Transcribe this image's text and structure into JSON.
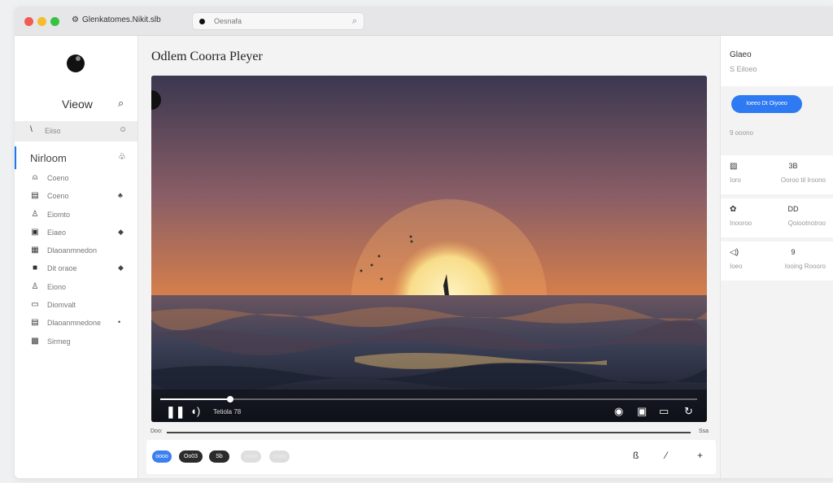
{
  "window": {
    "app_title": "Glenkatomes.Nikit.slb",
    "address": "Oesnafa"
  },
  "sidebar": {
    "view_label": "Vieow",
    "top_item": {
      "label": "Eiiso"
    },
    "section": {
      "label": "Nirloom"
    },
    "items": [
      {
        "label": "Coeno",
        "icon": "person-icon",
        "glyph": "⍝"
      },
      {
        "label": "Coeno",
        "icon": "folder-icon",
        "glyph": "▤",
        "badge": "♣"
      },
      {
        "label": "Eiomto",
        "icon": "person-icon",
        "glyph": "♙"
      },
      {
        "label": "Eiaeo",
        "icon": "calendar-icon",
        "glyph": "▣",
        "badge": "◆"
      },
      {
        "label": "Dlaoanmnedon",
        "icon": "grid-icon",
        "glyph": "▦"
      },
      {
        "label": "Dit oraoe",
        "icon": "stack-icon",
        "glyph": "■",
        "badge": "◆"
      },
      {
        "label": "Eiono",
        "icon": "user-icon",
        "glyph": "♙"
      },
      {
        "label": "Diomvalt",
        "icon": "window-icon",
        "glyph": "▭"
      },
      {
        "label": "Dlaoanmnedone",
        "icon": "layers-icon",
        "glyph": "▤",
        "badge": "•"
      },
      {
        "label": "Sirmeg",
        "icon": "settings-icon",
        "glyph": "▩"
      }
    ]
  },
  "main": {
    "title": "Odlem Coorra Pleyer",
    "player": {
      "time": "Tetiola 78",
      "progress": 0.13,
      "timeline_start": "Doo:",
      "timeline_end": "Ssa"
    },
    "bottom_bar": {
      "pills": [
        {
          "label": "oooo",
          "color": "#3b7ff0"
        },
        {
          "label": "Oo03",
          "color": "#2b2b2b"
        },
        {
          "label": "Sb",
          "color": "#2b2b2b"
        },
        {
          "label": "oooo",
          "color": "#dedede"
        },
        {
          "label": "oooo",
          "color": "#dedede"
        }
      ]
    }
  },
  "right_panel": {
    "title": "Glaeo",
    "subtitle": "S  Eiloeo",
    "button": "Ioeeo Dt Oiyoeo",
    "note": "9 ooono",
    "cards": [
      {
        "top_right": "3B",
        "bottom_left": "Ioro",
        "bottom_right": "Ooroo til Iroono"
      },
      {
        "top_right": "DD",
        "bottom_left": "Inooroo",
        "bottom_right": "Qoiootnotroo"
      },
      {
        "top_right": "9",
        "bottom_left": "Ioeo",
        "bottom_right": "Iooing Roooro"
      }
    ]
  },
  "colors": {
    "accent": "#2e7af3",
    "sidebar_active": "#1e77f2"
  }
}
